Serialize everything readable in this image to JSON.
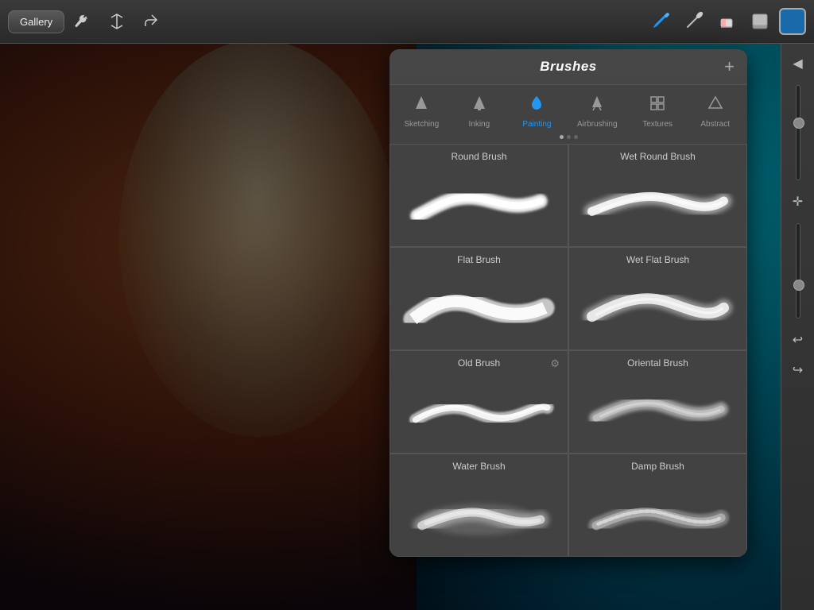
{
  "toolbar": {
    "gallery_label": "Gallery",
    "title": "Brushes",
    "add_label": "+"
  },
  "categories": [
    {
      "id": "sketching",
      "label": "Sketching",
      "icon": "▲",
      "active": false
    },
    {
      "id": "inking",
      "label": "Inking",
      "icon": "▲",
      "active": false
    },
    {
      "id": "painting",
      "label": "Painting",
      "icon": "💧",
      "active": true
    },
    {
      "id": "airbrushing",
      "label": "Airbrushing",
      "icon": "▲",
      "active": false
    },
    {
      "id": "textures",
      "label": "Textures",
      "icon": "⊞",
      "active": false
    },
    {
      "id": "abstract",
      "label": "Abstract",
      "icon": "△",
      "active": false
    }
  ],
  "brushes": [
    {
      "id": "round-brush",
      "name": "Round Brush",
      "gear": false
    },
    {
      "id": "wet-round-brush",
      "name": "Wet Round Brush",
      "gear": false
    },
    {
      "id": "flat-brush",
      "name": "Flat Brush",
      "gear": false
    },
    {
      "id": "wet-flat-brush",
      "name": "Wet Flat Brush",
      "gear": false
    },
    {
      "id": "old-brush",
      "name": "Old Brush",
      "gear": true
    },
    {
      "id": "oriental-brush",
      "name": "Oriental Brush",
      "gear": false
    },
    {
      "id": "water-brush",
      "name": "Water Brush",
      "gear": false
    },
    {
      "id": "damp-brush",
      "name": "Damp Brush",
      "gear": false
    }
  ],
  "colors": {
    "accent_blue": "#2196F3",
    "panel_bg": "#424242",
    "panel_border": "#555555"
  }
}
